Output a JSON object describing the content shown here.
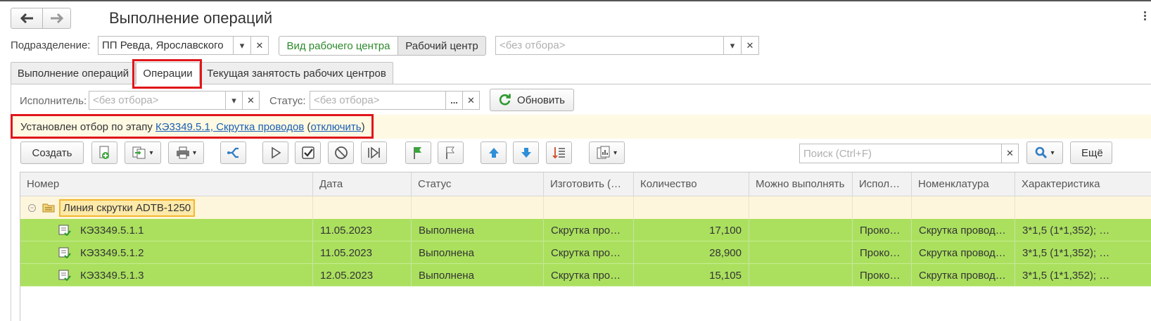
{
  "window": {
    "title": "Выполнение операций"
  },
  "filters": {
    "subdivision_label": "Подразделение:",
    "subdivision_value": "ПП Ревда, Ярославского",
    "wc_type_button": "Вид рабочего центра",
    "wc_button": "Рабочий центр",
    "wc_filter_placeholder": "<без отбора>"
  },
  "tabs": [
    {
      "label": "Выполнение операций"
    },
    {
      "label": "Операции"
    },
    {
      "label": "Текущая занятость рабочих центров"
    }
  ],
  "subfilters": {
    "executor_label": "Исполнитель:",
    "executor_placeholder": "<без отбора>",
    "status_label": "Статус:",
    "status_placeholder": "<без отбора>",
    "refresh_label": "Обновить",
    "ellipsis": "..."
  },
  "notice": {
    "prefix": "Установлен отбор по этапу ",
    "stage_link": "КЭ3349.5.1, Скрутка проводов",
    "open_paren": " (",
    "disable_link": "отключить",
    "close_paren": ")"
  },
  "toolbar": {
    "create_label": "Создать",
    "search_placeholder": "Поиск (Ctrl+F)",
    "more_label": "Ещё"
  },
  "table": {
    "columns": [
      "Номер",
      "Дата",
      "Статус",
      "Изготовить (…",
      "Количество",
      "Можно выполнять",
      "Испол…",
      "Номенклатура",
      "Характеристика"
    ],
    "group": {
      "label": "Линия скрутки ADTB-1250"
    },
    "rows": [
      {
        "number": "КЭ3349.5.1.1",
        "date": "11.05.2023",
        "status": "Выполнена",
        "make": "Скрутка про…",
        "qty": "17,100",
        "can": "",
        "exec": "Проко…",
        "nomen": "Скрутка провод…",
        "char": "3*1,5 (1*1,352); …"
      },
      {
        "number": "КЭ3349.5.1.2",
        "date": "11.05.2023",
        "status": "Выполнена",
        "make": "Скрутка про…",
        "qty": "28,900",
        "can": "",
        "exec": "Проко…",
        "nomen": "Скрутка провод…",
        "char": "3*1,5 (1*1,352); …"
      },
      {
        "number": "КЭ3349.5.1.3",
        "date": "12.05.2023",
        "status": "Выполнена",
        "make": "Скрутка про…",
        "qty": "15,105",
        "can": "",
        "exec": "Проко…",
        "nomen": "Скрутка провод…",
        "char": "3*1,5 (1*1,352); …"
      }
    ]
  },
  "colors": {
    "accent_red": "#e0161b",
    "row_green": "#abe05f",
    "group_highlight": "#fef6dc",
    "link_blue": "#1a5fb4"
  }
}
